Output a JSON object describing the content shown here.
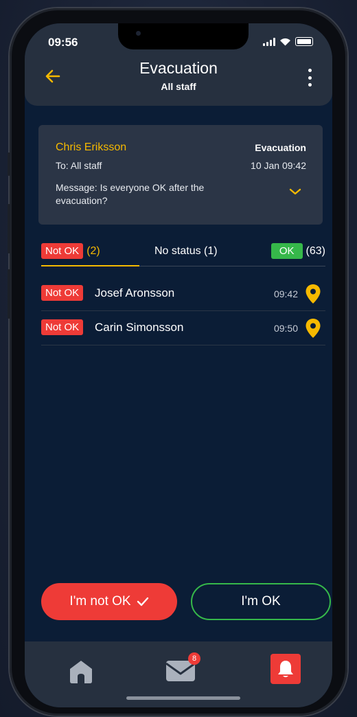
{
  "status_bar": {
    "time": "09:56"
  },
  "header": {
    "title": "Evacuation",
    "subtitle": "All staff"
  },
  "message": {
    "sender": "Chris Eriksson",
    "recipient": "To: All staff",
    "type": "Evacuation",
    "timestamp": "10 Jan 09:42",
    "text": "Message: Is everyone OK after the evacuation?"
  },
  "tabs": [
    {
      "badge": "Not OK",
      "count": "(2)"
    },
    {
      "label": "No status (1)"
    },
    {
      "badge": "OK",
      "count": "(63)"
    }
  ],
  "responses": [
    {
      "status": "Not OK",
      "name": "Josef Aronsson",
      "time": "09:42"
    },
    {
      "status": "Not OK",
      "name": "Carin Simonsson",
      "time": "09:50"
    }
  ],
  "actions": {
    "not_ok_label": "I'm not OK",
    "ok_label": "I'm OK"
  },
  "nav": {
    "mail_badge": "8"
  },
  "colors": {
    "accent": "#f6b900",
    "danger": "#ee3b37",
    "success": "#36b84a",
    "background": "#0b1d36"
  },
  "icons": [
    "back-arrow-icon",
    "more-vertical-icon",
    "chevron-down-icon",
    "location-pin-icon",
    "checkmark-icon",
    "home-icon",
    "mail-icon",
    "bell-icon"
  ]
}
